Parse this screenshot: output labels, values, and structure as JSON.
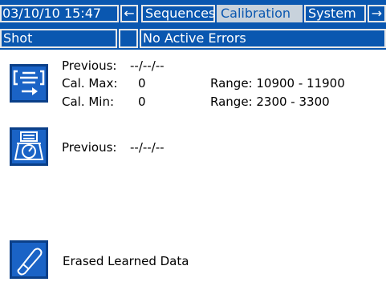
{
  "header": {
    "datetime": "03/10/10 15:47",
    "left_arrow": "←",
    "tabs": [
      {
        "label": "Sequences",
        "active": false
      },
      {
        "label": "Calibration",
        "active": true
      },
      {
        "label": "System",
        "active": false
      }
    ],
    "right_arrow": "→"
  },
  "status": {
    "mode": "Shot",
    "errors": "No Active Errors"
  },
  "shot_cal": {
    "icon": "shot-calibration-icon",
    "previous_label": "Previous:",
    "previous_value": "--/--/--",
    "max_label": "Cal. Max:",
    "max_value": "0",
    "max_range": "Range: 10900 - 11900",
    "min_label": "Cal. Min:",
    "min_value": "0",
    "min_range": "Range: 2300 - 3300"
  },
  "scale_cal": {
    "icon": "scale-calibration-icon",
    "previous_label": "Previous:",
    "previous_value": "--/--/--"
  },
  "erase": {
    "icon": "eraser-icon",
    "label": "Erased Learned Data"
  },
  "colors": {
    "bar": "#0a57b0",
    "active_tab": "#c8d2dc",
    "button": "#1a63c6"
  }
}
